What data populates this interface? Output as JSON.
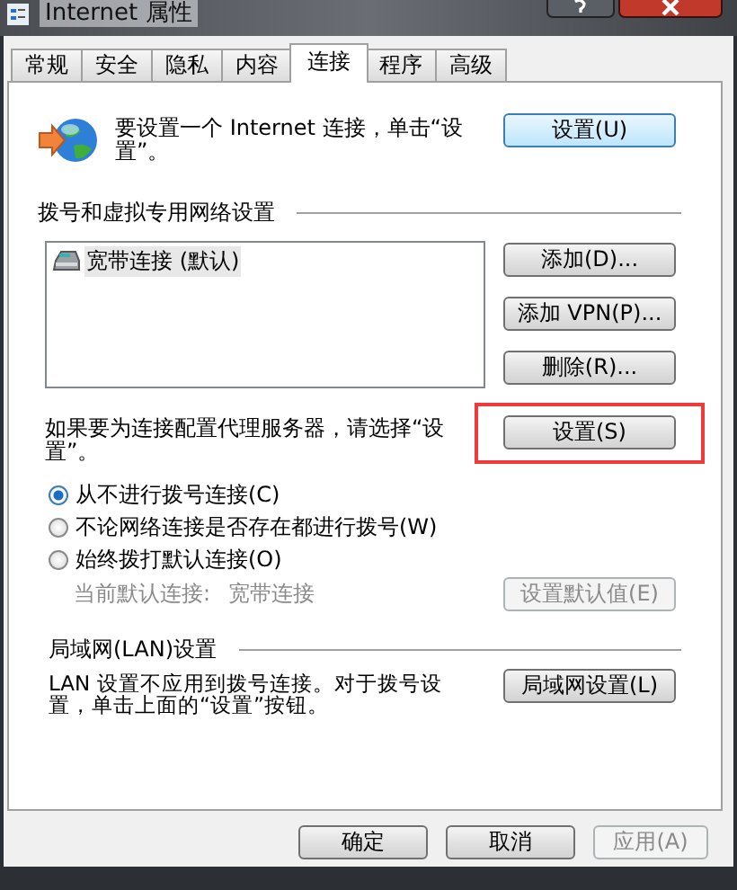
{
  "window": {
    "title": "Internet 属性"
  },
  "tabs": [
    {
      "label": "常规",
      "selected": false
    },
    {
      "label": "安全",
      "selected": false
    },
    {
      "label": "隐私",
      "selected": false
    },
    {
      "label": "内容",
      "selected": false
    },
    {
      "label": "连接",
      "selected": true
    },
    {
      "label": "程序",
      "selected": false
    },
    {
      "label": "高级",
      "selected": false
    }
  ],
  "setup": {
    "text": "要设置一个 Internet 连接，单击“设置”。",
    "button": "设置(U)"
  },
  "dialup": {
    "heading": "拨号和虚拟专用网络设置",
    "connections": [
      {
        "label": "宽带连接 (默认)",
        "selected": true
      }
    ],
    "buttons": [
      {
        "label": "添加(D)...",
        "disabled": false
      },
      {
        "label": "添加 VPN(P)...",
        "disabled": false
      },
      {
        "label": "删除(R)...",
        "disabled": false
      }
    ]
  },
  "proxy": {
    "text": "如果要为连接配置代理服务器，请选择“设置”。",
    "button": {
      "label": "设置(S)",
      "highlighted": true
    }
  },
  "dial_options": [
    {
      "label": "从不进行拨号连接(C)",
      "selected": true
    },
    {
      "label": "不论网络连接是否存在都进行拨号(W)",
      "selected": false
    },
    {
      "label": "始终拨打默认连接(O)",
      "selected": false
    }
  ],
  "current_default": {
    "label": "当前默认连接:",
    "value": "宽带连接",
    "button": {
      "label": "设置默认值(E)",
      "disabled": true
    }
  },
  "lan": {
    "heading": "局域网(LAN)设置",
    "text": "LAN 设置不应用到拨号连接。对于拨号设置，单击上面的“设置”按钮。",
    "button": "局域网设置(L)"
  },
  "footer_buttons": [
    {
      "label": "确定",
      "disabled": false
    },
    {
      "label": "取消",
      "disabled": false
    },
    {
      "label": "应用(A)",
      "disabled": true
    }
  ]
}
